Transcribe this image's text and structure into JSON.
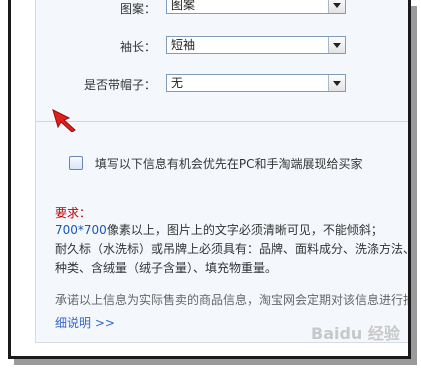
{
  "form": {
    "top_row": {
      "label": "图案：",
      "value": "图案"
    },
    "sleeve": {
      "label": "袖长：",
      "value": "短袖"
    },
    "hood": {
      "label": "是否带帽子：",
      "value": "无"
    }
  },
  "checkbox": {
    "label": "填写以下信息有机会优先在PC和手淘端展现给买家",
    "checked": false
  },
  "requirements": {
    "title": "要求：",
    "line1_num": "700*700",
    "line1_text": "像素以上，图片上的文字必须清晰可见，不能倾斜；",
    "line2": "耐久标（水洗标）或吊牌上必须具有：品牌、面料成分、洗涤方法、安",
    "line3": "种类、含绒量（绒子含量）、填充物重量。"
  },
  "note": "承诺以上信息为实际售卖的商品信息，淘宝网会定期对该信息进行抽查",
  "link": "细说明 >>",
  "watermark": "Baidu 经验"
}
